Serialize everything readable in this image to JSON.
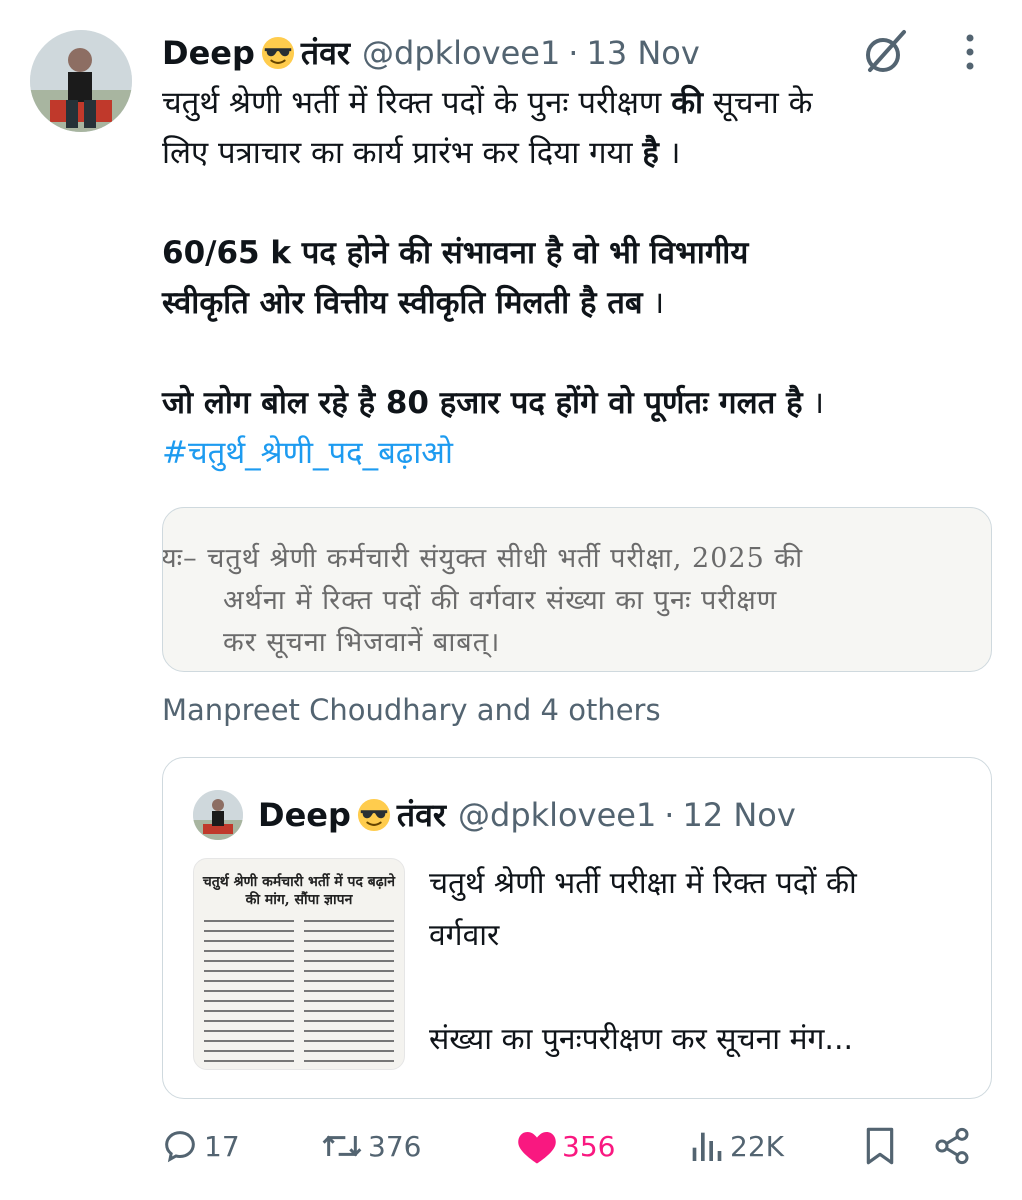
{
  "tweet": {
    "author_name": "Deep",
    "author_name_suffix": "तंवर",
    "handle": "@dpklovee1",
    "separator": "·",
    "date": "13 Nov",
    "lines": [
      {
        "normal_before": "चतुर्थ श्रेणी भर्ती में रिक्त पदों के पुनः परीक्षण ",
        "bold": "की",
        "normal_after": " सूचना के"
      },
      {
        "normal_before": "लिए पत्राचार का कार्य प्रारंभ कर दिया गया ",
        "bold": "है",
        "normal_after": " ।"
      }
    ],
    "bold_line_1": " 60/65 k पद होने की संभावना है वो भी विभागीय",
    "bold_line_2": "स्वीकृति ओर वित्तीय स्वीकृति मिलती है तब",
    "bold_line_2_end": " ।",
    "bold_line_3": "जो लोग बोल रहे है 80 हजार पद होंगे वो पूर्णतः गलत है",
    "bold_line_3_end": " ।",
    "hashtag": "#चतुर्थ_श्रेणी_पद_बढ़ाओ"
  },
  "doc_image": {
    "line_1": "यः– चतुर्थ श्रेणी कर्मचारी संयुक्त सीधी भर्ती परीक्षा, 2025 की",
    "line_2": "अर्थना में रिक्त पदों की वर्गवार संख्या का पुनः परीक्षण",
    "line_3": "कर सूचना भिजवानें बाबत्।"
  },
  "liked_by": "Manpreet Choudhary and 4 others",
  "quoted_tweet": {
    "author_name": "Deep",
    "author_name_suffix": "तंवर",
    "handle": "@dpklovee1",
    "separator": "·",
    "date": "12 Nov",
    "text_line_1": "चतुर्थ श्रेणी भर्ती परीक्षा में  रिक्त पदों की",
    "text_line_2": "वर्गवार",
    "text_line_3": "संख्या का पुनःपरीक्षण कर सूचना मंग...",
    "thumbnail_headline": "चतुर्थ श्रेणी कर्मचारी भर्ती में पद बढ़ाने की मांग, सौंपा ज्ञापन"
  },
  "actions": {
    "replies": "17",
    "retweets": "376",
    "likes": "356",
    "views": "22K"
  },
  "colors": {
    "text": "#0f1419",
    "secondary": "#536471",
    "link": "#1d9bf0",
    "like": "#f91880",
    "border": "#cfd9de"
  },
  "icons": [
    "grok-icon",
    "more-icon",
    "sunglasses-emoji",
    "reply-icon",
    "retweet-icon",
    "like-icon",
    "views-icon",
    "bookmark-icon",
    "share-icon"
  ]
}
